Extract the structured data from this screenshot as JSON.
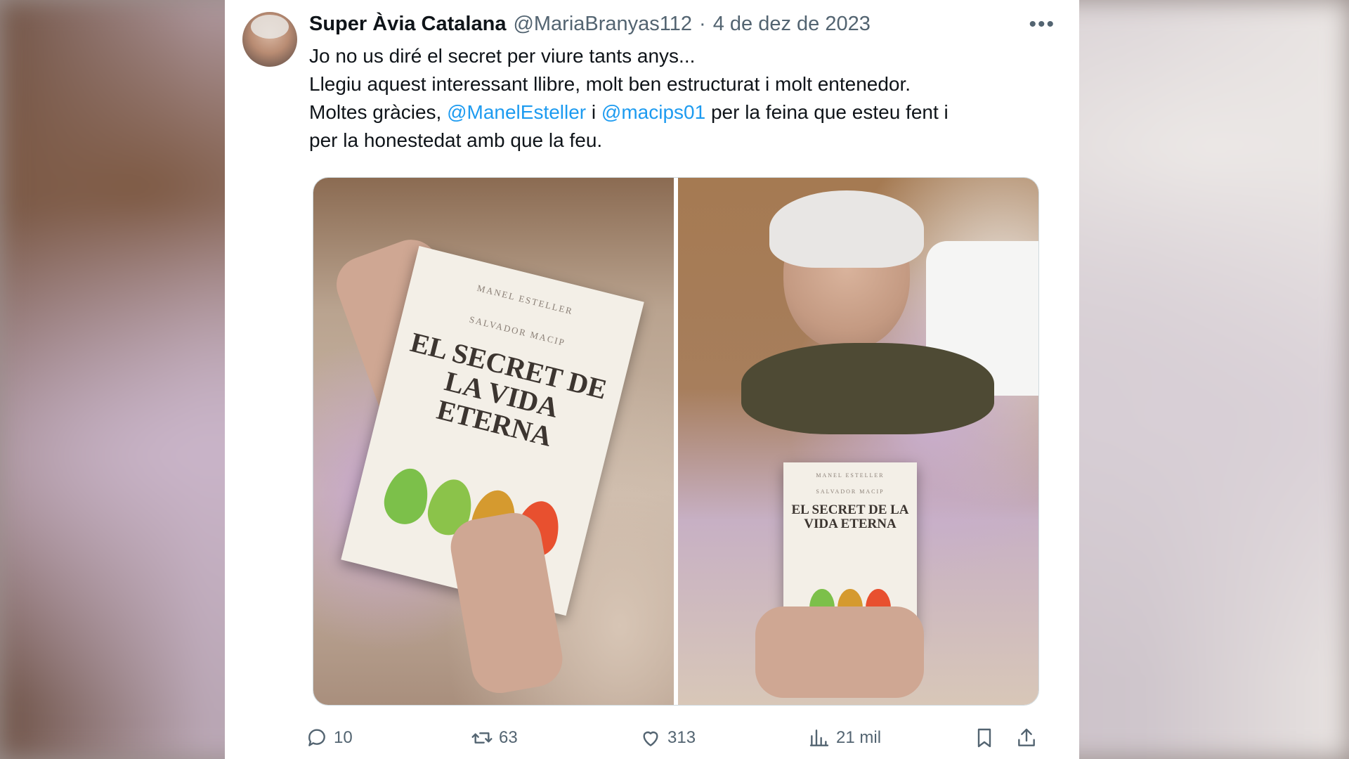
{
  "tweet": {
    "author_name": "Super Àvia Catalana",
    "handle": "@MariaBranyas112",
    "separator": "·",
    "date": "4 de dez de 2023",
    "more_icon": "more-horizontal-icon",
    "text": {
      "line1": "Jo no us diré el secret per viure tants anys...",
      "line2": "Llegiu aquest interessant llibre, molt ben estructurat i molt entenedor.",
      "line3_before": "Moltes gràcies, ",
      "mention1": "@ManelEsteller",
      "line3_mid": " i ",
      "mention2": "@macips01",
      "line3_after": " per la feina que esteu fent i",
      "line4": "per la honestedat amb que la feu."
    },
    "media": {
      "photos": [
        {
          "book_authors_line1": "MANEL ESTELLER",
          "book_authors_line2": "SALVADOR MACIP",
          "book_title": "EL SECRET DE LA VIDA ETERNA"
        },
        {
          "book_authors_line1": "MANEL ESTELLER",
          "book_authors_line2": "SALVADOR MACIP",
          "book_title": "EL SECRET DE LA VIDA ETERNA"
        }
      ]
    },
    "actions": {
      "replies": "10",
      "retweets": "63",
      "likes": "313",
      "views": "21 mil"
    }
  },
  "colors": {
    "text_primary": "#0f1419",
    "text_secondary": "#536471",
    "mention": "#1d9bf0",
    "leaf_colors": [
      "#7cc04a",
      "#8bc34a",
      "#d59a2f",
      "#e8502f"
    ]
  }
}
